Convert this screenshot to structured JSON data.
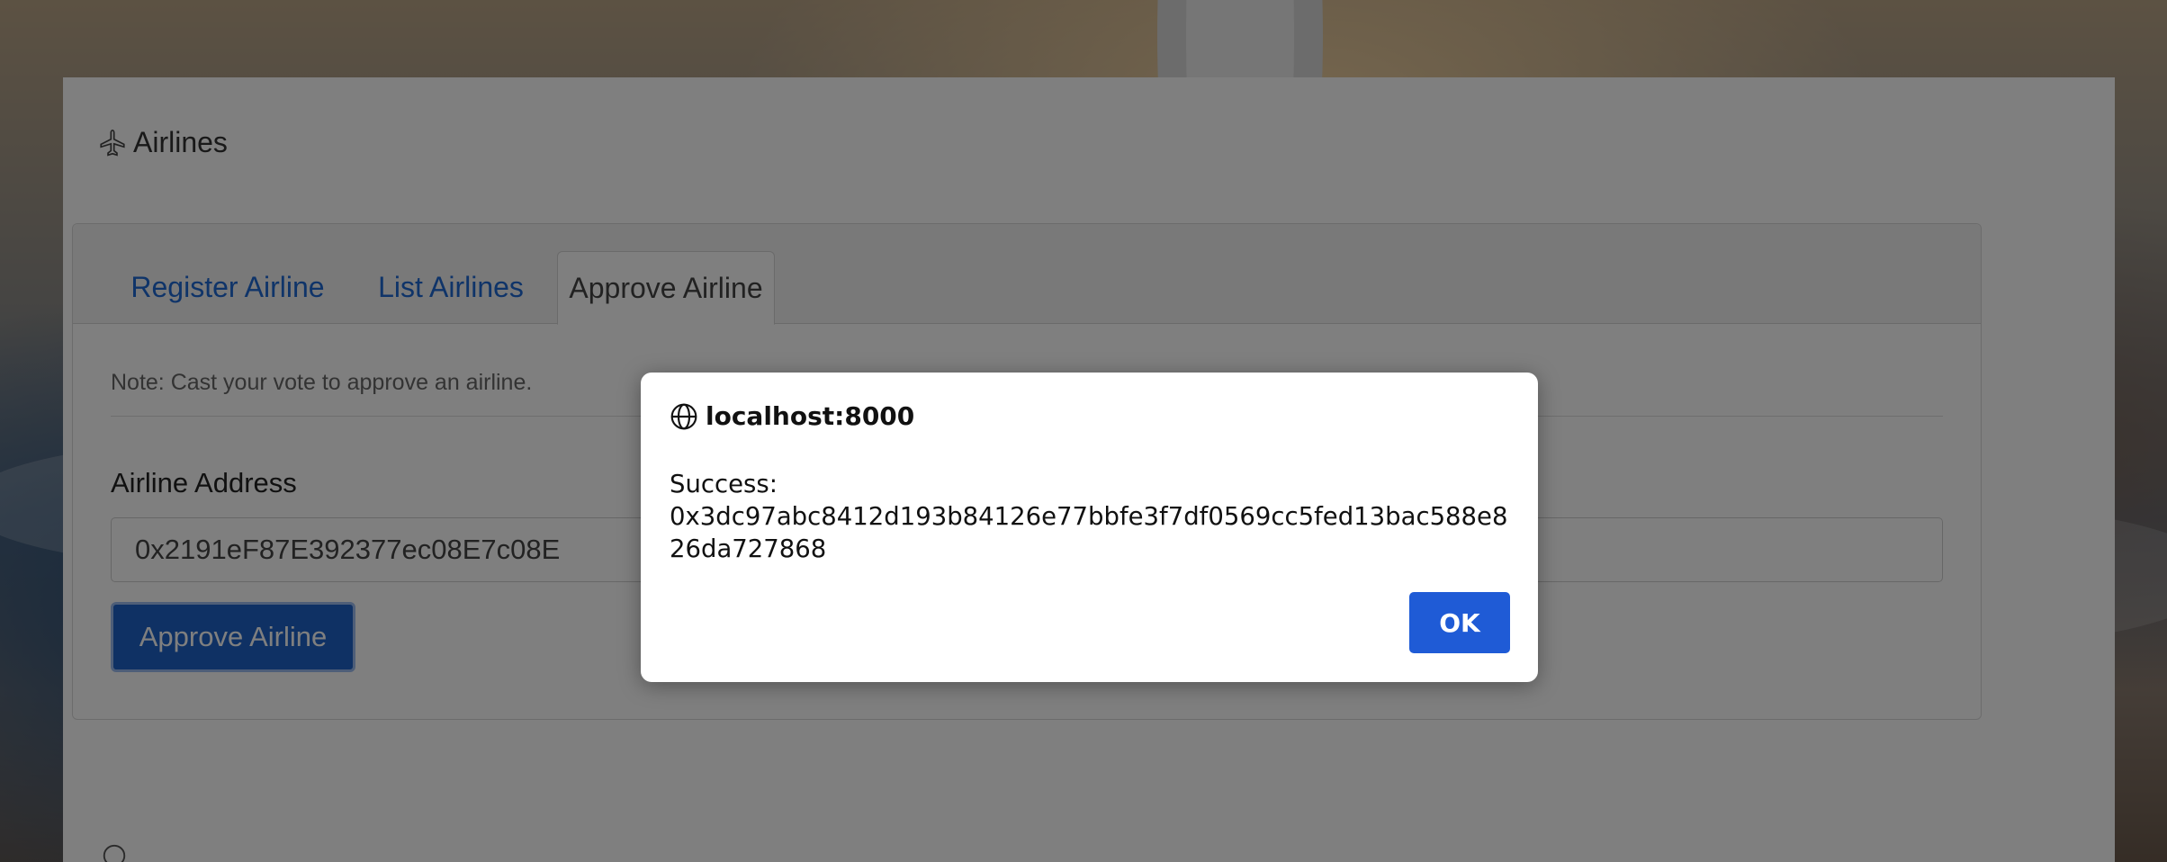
{
  "section": {
    "title": "Airlines",
    "icon": "airplane-icon"
  },
  "tabs": [
    {
      "label": "Register Airline"
    },
    {
      "label": "List Airlines"
    },
    {
      "label": "Approve Airline",
      "active": true
    }
  ],
  "form": {
    "note": "Note: Cast your vote to approve an airline.",
    "address_label": "Airline Address",
    "address_value": "0x2191eF87E392377ec08E7c08E",
    "submit_label": "Approve Airline"
  },
  "dialog": {
    "origin": "localhost:8000",
    "origin_icon": "globe-icon",
    "message": "Success:\n0x3dc97abc8412d193b84126e77bbfe3f7df0569cc5fed13bac588e826da727868",
    "ok_label": "OK"
  },
  "colors": {
    "link": "#1e68d2",
    "primary_button": "#1e63c8",
    "dialog_ok": "#1f5bd6"
  }
}
